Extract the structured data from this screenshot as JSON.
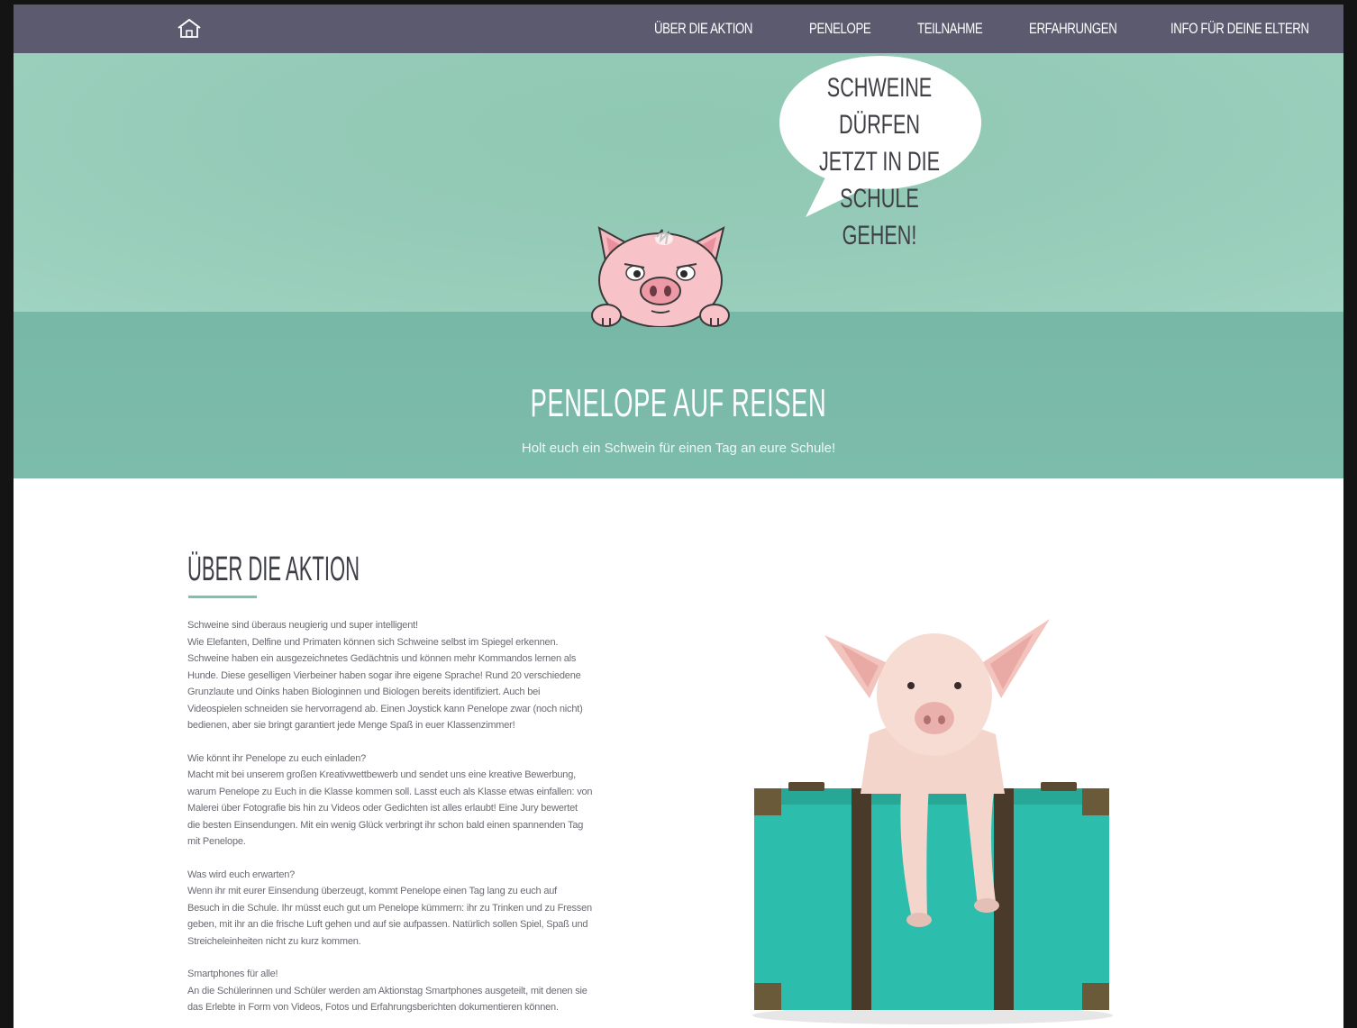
{
  "nav": {
    "items": [
      {
        "label": "Über die Aktion"
      },
      {
        "label": "Penelope"
      },
      {
        "label": "Teilnahme"
      },
      {
        "label": "Erfahrungen"
      },
      {
        "label": "Info für deine Eltern"
      }
    ]
  },
  "hero": {
    "bubble_lines": [
      "Schweine",
      "dürfen jetzt in die",
      "Schule gehen!"
    ],
    "title": "Penelope auf Reisen",
    "subtitle": "Holt euch ein Schwein für einen Tag an eure Schule!"
  },
  "section": {
    "title": "Über die Aktion",
    "paragraphs": [
      {
        "lines": [
          "Schweine sind überaus neugierig und super intelligent!",
          "Wie Elefanten, Delfine und Primaten können sich Schweine selbst im Spiegel erkennen.",
          "Schweine haben ein ausgezeichnetes Gedächtnis und können mehr Kommandos lernen als",
          "Hunde. Diese geselligen Vierbeiner haben sogar ihre eigene Sprache! Rund 20 verschiedene",
          "Grunzlaute und Oinks haben Biologinnen und Biologen bereits identifiziert. Auch bei",
          "Videospielen schneiden sie hervorragend ab. Einen Joystick kann Penelope zwar (noch nicht)",
          "bedienen, aber sie bringt garantiert jede Menge Spaß in euer Klassenzimmer!"
        ]
      },
      {
        "lines": [
          "Wie könnt ihr Penelope zu euch einladen?",
          "Macht mit bei unserem großen Kreativwettbewerb und sendet uns eine kreative Bewerbung,",
          "warum Penelope zu Euch in die Klasse kommen soll. Lasst euch als Klasse etwas einfallen: von",
          "Malerei über Fotografie bis hin zu Videos oder Gedichten ist alles erlaubt! Eine Jury bewertet",
          "die besten Einsendungen. Mit ein wenig Glück verbringt ihr schon bald einen spannenden Tag",
          "mit Penelope."
        ]
      },
      {
        "lines": [
          "Was wird euch erwarten?",
          "Wenn ihr mit eurer Einsendung überzeugt, kommt Penelope einen Tag lang zu euch auf",
          "Besuch in die Schule. Ihr müsst euch gut um Penelope kümmern: ihr zu Trinken und zu Fressen",
          "geben, mit ihr an die frische Luft gehen und auf sie aufpassen. Natürlich sollen Spiel, Spaß und",
          "Streicheleinheiten nicht zu kurz kommen."
        ]
      },
      {
        "lines": [
          "Smartphones für alle!",
          "An die Schülerinnen und Schüler werden am Aktionstag Smartphones ausgeteilt, mit denen sie",
          "das Erlebte in Form von Videos, Fotos und Erfahrungsberichten dokumentieren können."
        ]
      }
    ]
  },
  "icons": {
    "home": "home-icon",
    "cartoon": "cartoon-pig-illustration",
    "photo": "piglet-on-suitcase-photo"
  },
  "colors": {
    "nav_bg": "#5b5a6f",
    "hero_light": "#95cbb8",
    "hero_dark": "#7dbcaa",
    "accent": "#7fc1ae",
    "suitcase": "#2dbdac"
  }
}
